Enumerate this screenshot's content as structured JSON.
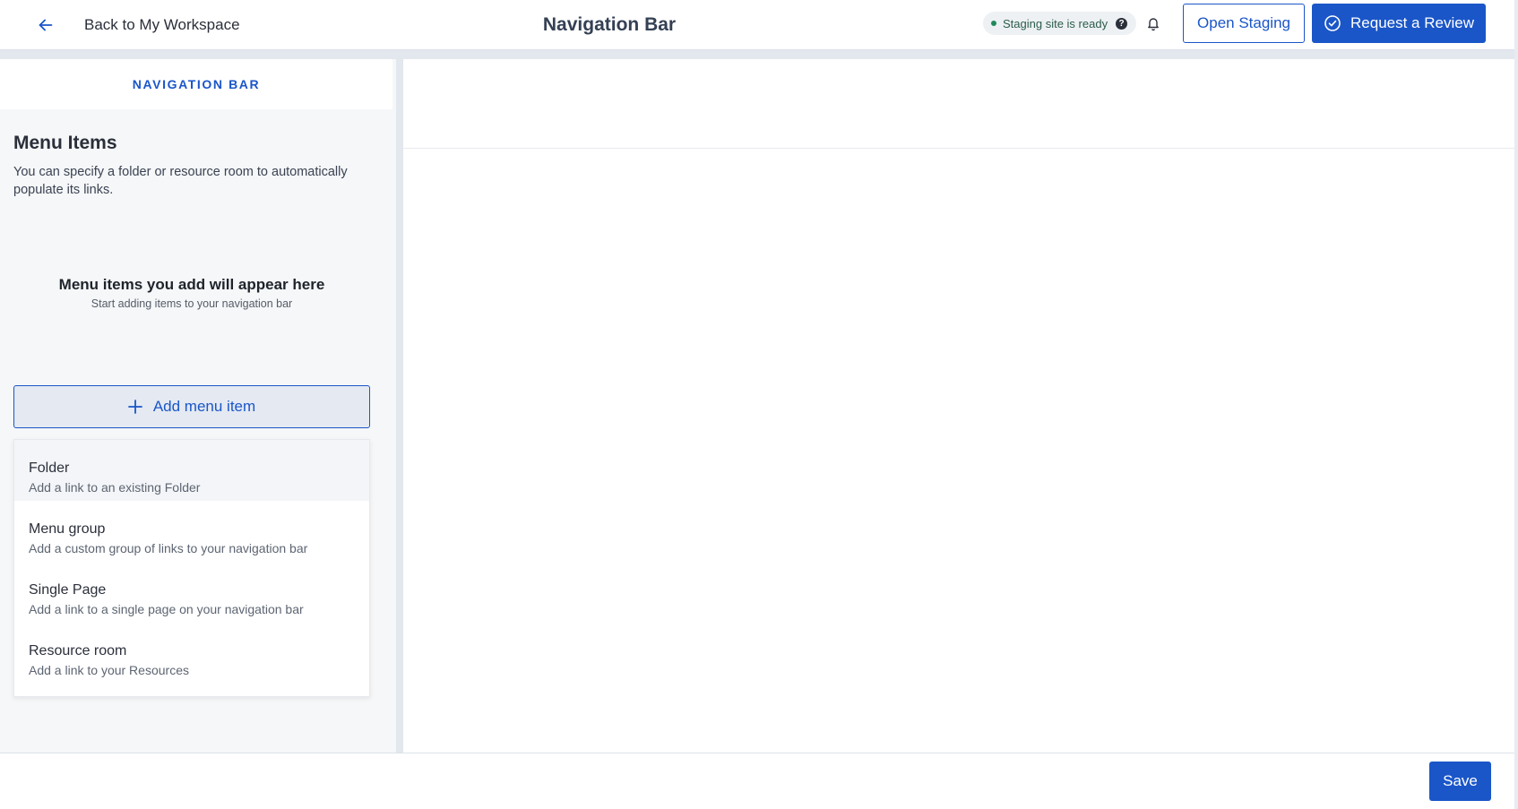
{
  "header": {
    "back_label": "Back to My Workspace",
    "title": "Navigation Bar",
    "status_text": "Staging site is ready",
    "open_staging_label": "Open Staging",
    "request_review_label": "Request a Review"
  },
  "sidebar": {
    "tab_label": "NAVIGATION BAR",
    "section_title": "Menu Items",
    "section_description": "You can specify a folder or resource room to automatically populate its links.",
    "empty_title": "Menu items you add will appear here",
    "empty_subtitle": "Start adding items to your navigation bar",
    "add_button_label": "Add menu item",
    "menu_options": [
      {
        "title": "Folder",
        "description": "Add a link to an existing Folder"
      },
      {
        "title": "Menu group",
        "description": "Add a custom group of links to your navigation bar"
      },
      {
        "title": "Single Page",
        "description": "Add a link to a single page on your navigation bar"
      },
      {
        "title": "Resource room",
        "description": "Add a link to your Resources"
      }
    ]
  },
  "footer": {
    "save_label": "Save"
  },
  "colors": {
    "accent": "#1a56c8",
    "status_dot": "#1e8a5a",
    "panel_bg": "#f5f7f8"
  },
  "icons": [
    "arrow-left-icon",
    "help-icon",
    "bell-icon",
    "check-circle-icon",
    "plus-icon"
  ]
}
